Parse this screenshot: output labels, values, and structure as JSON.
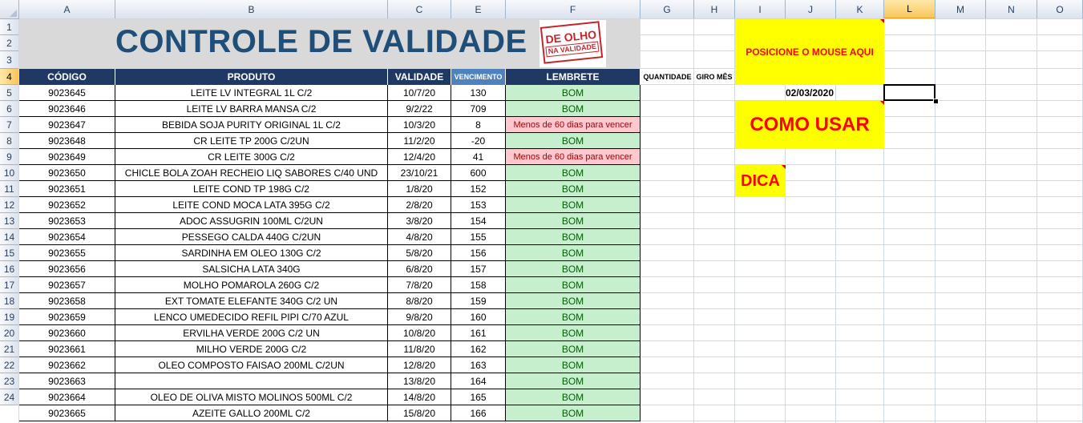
{
  "column_headers": [
    "A",
    "B",
    "C",
    "E",
    "F",
    "G",
    "H",
    "I",
    "J",
    "K",
    "L",
    "M",
    "N",
    "O"
  ],
  "selected_column": "L",
  "row_headers": [
    "1",
    "2",
    "3",
    "4",
    "5",
    "6",
    "7",
    "8",
    "9",
    "10",
    "11",
    "12",
    "13",
    "14",
    "15",
    "16",
    "17",
    "18",
    "19",
    "20",
    "21",
    "22",
    "23",
    "24"
  ],
  "selected_row": "4",
  "title": "CONTROLE DE VALIDADE",
  "stamp": {
    "line1": "DE OLHO",
    "line2": "NA VALIDADE"
  },
  "headers": {
    "codigo": "CÓDIGO",
    "produto": "PRODUTO",
    "validade": "VALIDADE",
    "vencimento": "VENCIMENTO",
    "lembrete": "LEMBRETE",
    "quantidade": "QUANTIDADE",
    "giro": "GIRO MÊS"
  },
  "rows": [
    {
      "codigo": "9023645",
      "produto": "LEITE LV INTEGRAL 1L C/2",
      "validade": "10/7/20",
      "vencimento": "130",
      "lembrete": "BOM",
      "status": "ok"
    },
    {
      "codigo": "9023646",
      "produto": "LEITE LV BARRA MANSA C/2",
      "validade": "9/2/22",
      "vencimento": "709",
      "lembrete": "BOM",
      "status": "ok"
    },
    {
      "codigo": "9023647",
      "produto": "BEBIDA SOJA PURITY ORIGINAL 1L C/2",
      "validade": "10/3/20",
      "vencimento": "8",
      "lembrete": "Menos de 60 dias para vencer",
      "status": "warn"
    },
    {
      "codigo": "9023648",
      "produto": "CR LEITE TP 200G C/2UN",
      "validade": "11/2/20",
      "vencimento": "-20",
      "lembrete": "BOM",
      "status": "ok"
    },
    {
      "codigo": "9023649",
      "produto": "CR LEITE 300G C/2",
      "validade": "12/4/20",
      "vencimento": "41",
      "lembrete": "Menos de 60 dias para vencer",
      "status": "warn"
    },
    {
      "codigo": "9023650",
      "produto": "CHICLE BOLA ZOAH RECHEIO LIQ SABORES C/40 UND",
      "validade": "23/10/21",
      "vencimento": "600",
      "lembrete": "BOM",
      "status": "ok"
    },
    {
      "codigo": "9023651",
      "produto": "LEITE COND TP 198G C/2",
      "validade": "1/8/20",
      "vencimento": "152",
      "lembrete": "BOM",
      "status": "ok"
    },
    {
      "codigo": "9023652",
      "produto": "LEITE COND MOCA  LATA 395G C/2",
      "validade": "2/8/20",
      "vencimento": "153",
      "lembrete": "BOM",
      "status": "ok"
    },
    {
      "codigo": "9023653",
      "produto": "ADOC ASSUGRIN 100ML C/2UN",
      "validade": "3/8/20",
      "vencimento": "154",
      "lembrete": "BOM",
      "status": "ok"
    },
    {
      "codigo": "9023654",
      "produto": "PESSEGO CALDA 440G C/2UN",
      "validade": "4/8/20",
      "vencimento": "155",
      "lembrete": "BOM",
      "status": "ok"
    },
    {
      "codigo": "9023655",
      "produto": "SARDINHA EM OLEO 130G C/2",
      "validade": "5/8/20",
      "vencimento": "156",
      "lembrete": "BOM",
      "status": "ok"
    },
    {
      "codigo": "9023656",
      "produto": "SALSICHA LATA 340G",
      "validade": "6/8/20",
      "vencimento": "157",
      "lembrete": "BOM",
      "status": "ok"
    },
    {
      "codigo": "9023657",
      "produto": "MOLHO POMAROLA 260G C/2",
      "validade": "7/8/20",
      "vencimento": "158",
      "lembrete": "BOM",
      "status": "ok"
    },
    {
      "codigo": "9023658",
      "produto": "EXT TOMATE ELEFANTE 340G C/2 UN",
      "validade": "8/8/20",
      "vencimento": "159",
      "lembrete": "BOM",
      "status": "ok"
    },
    {
      "codigo": "9023659",
      "produto": "LENCO UMEDECIDO REFIL PIPI C/70 AZUL",
      "validade": "9/8/20",
      "vencimento": "160",
      "lembrete": "BOM",
      "status": "ok"
    },
    {
      "codigo": "9023660",
      "produto": "ERVILHA VERDE 200G C/2 UN",
      "validade": "10/8/20",
      "vencimento": "161",
      "lembrete": "BOM",
      "status": "ok"
    },
    {
      "codigo": "9023661",
      "produto": "MILHO VERDE 200G C/2",
      "validade": "11/8/20",
      "vencimento": "162",
      "lembrete": "BOM",
      "status": "ok"
    },
    {
      "codigo": "9023662",
      "produto": "OLEO COMPOSTO FAISAO 200ML C/2UN",
      "validade": "12/8/20",
      "vencimento": "163",
      "lembrete": "BOM",
      "status": "ok"
    },
    {
      "codigo": "9023663",
      "produto": "",
      "validade": "13/8/20",
      "vencimento": "164",
      "lembrete": "BOM",
      "status": "ok"
    },
    {
      "codigo": "9023664",
      "produto": "OLEO DE OLIVA MISTO MOLINOS 500ML C/2",
      "validade": "14/8/20",
      "vencimento": "165",
      "lembrete": "BOM",
      "status": "ok"
    },
    {
      "codigo": "9023665",
      "produto": "AZEITE GALLO 200ML C/2",
      "validade": "15/8/20",
      "vencimento": "166",
      "lembrete": "BOM",
      "status": "ok"
    }
  ],
  "side": {
    "mouse_hint": "POSICIONE O MOUSE AQUI",
    "date": "02/03/2020",
    "como_usar": "COMO USAR",
    "dica": "DICA"
  },
  "colors": {
    "title": "#1f4e79",
    "header_bg": "#1f3864",
    "ok_bg": "#c6efce",
    "ok_text": "#006100",
    "warn_bg": "#ffc7ce",
    "warn_text": "#9c0006",
    "note_bg": "#ffff00",
    "note_text": "#ff0000"
  }
}
